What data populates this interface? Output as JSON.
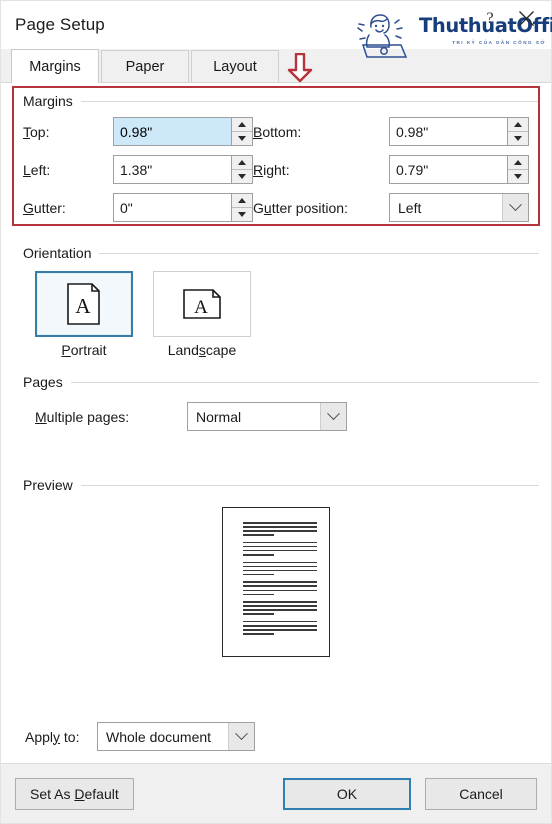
{
  "window": {
    "title": "Page Setup",
    "help_icon": "question-mark-icon",
    "close_icon": "close-icon"
  },
  "watermark": {
    "brand": "ThuthuatOffice",
    "tagline": "TRI KỶ CỦA DÂN CÔNG SỞ",
    "brand_color": "#173d7a"
  },
  "annotation": {
    "arrow_color": "#b5333a",
    "box_color": "#b5333a"
  },
  "tabs": [
    {
      "label": "Margins",
      "active": true
    },
    {
      "label": "Paper",
      "active": false
    },
    {
      "label": "Layout",
      "active": false
    }
  ],
  "margins": {
    "group_label": "Margins",
    "top": {
      "label": "Top:",
      "accel": "T",
      "value": "0.98\"",
      "selected": true
    },
    "bottom": {
      "label": "Bottom:",
      "accel": "B",
      "value": "0.98\"",
      "selected": false
    },
    "left": {
      "label": "Left:",
      "accel": "L",
      "value": "1.38\"",
      "selected": false
    },
    "right": {
      "label": "Right:",
      "accel": "R",
      "value": "0.79\"",
      "selected": false
    },
    "gutter": {
      "label": "Gutter:",
      "accel": "G",
      "value": "0\"",
      "selected": false
    },
    "gutter_position": {
      "label": "Gutter position:",
      "accel": "u",
      "value": "Left"
    }
  },
  "orientation": {
    "group_label": "Orientation",
    "options": [
      {
        "label": "Portrait",
        "accel": "P",
        "selected": true
      },
      {
        "label": "Landscape",
        "accel": "s",
        "selected": false
      }
    ]
  },
  "pages": {
    "group_label": "Pages",
    "multiple_pages": {
      "label": "Multiple pages:",
      "accel": "M",
      "value": "Normal"
    }
  },
  "preview": {
    "group_label": "Preview",
    "paragraphs": 6,
    "lines_per_paragraph": 4
  },
  "apply_to": {
    "label": "Apply to:",
    "accel": "y",
    "value": "Whole document"
  },
  "footer": {
    "set_as_default": "Set As Default",
    "set_as_default_accel": "D",
    "ok": "OK",
    "cancel": "Cancel",
    "focus_color": "#2f7fb5"
  }
}
